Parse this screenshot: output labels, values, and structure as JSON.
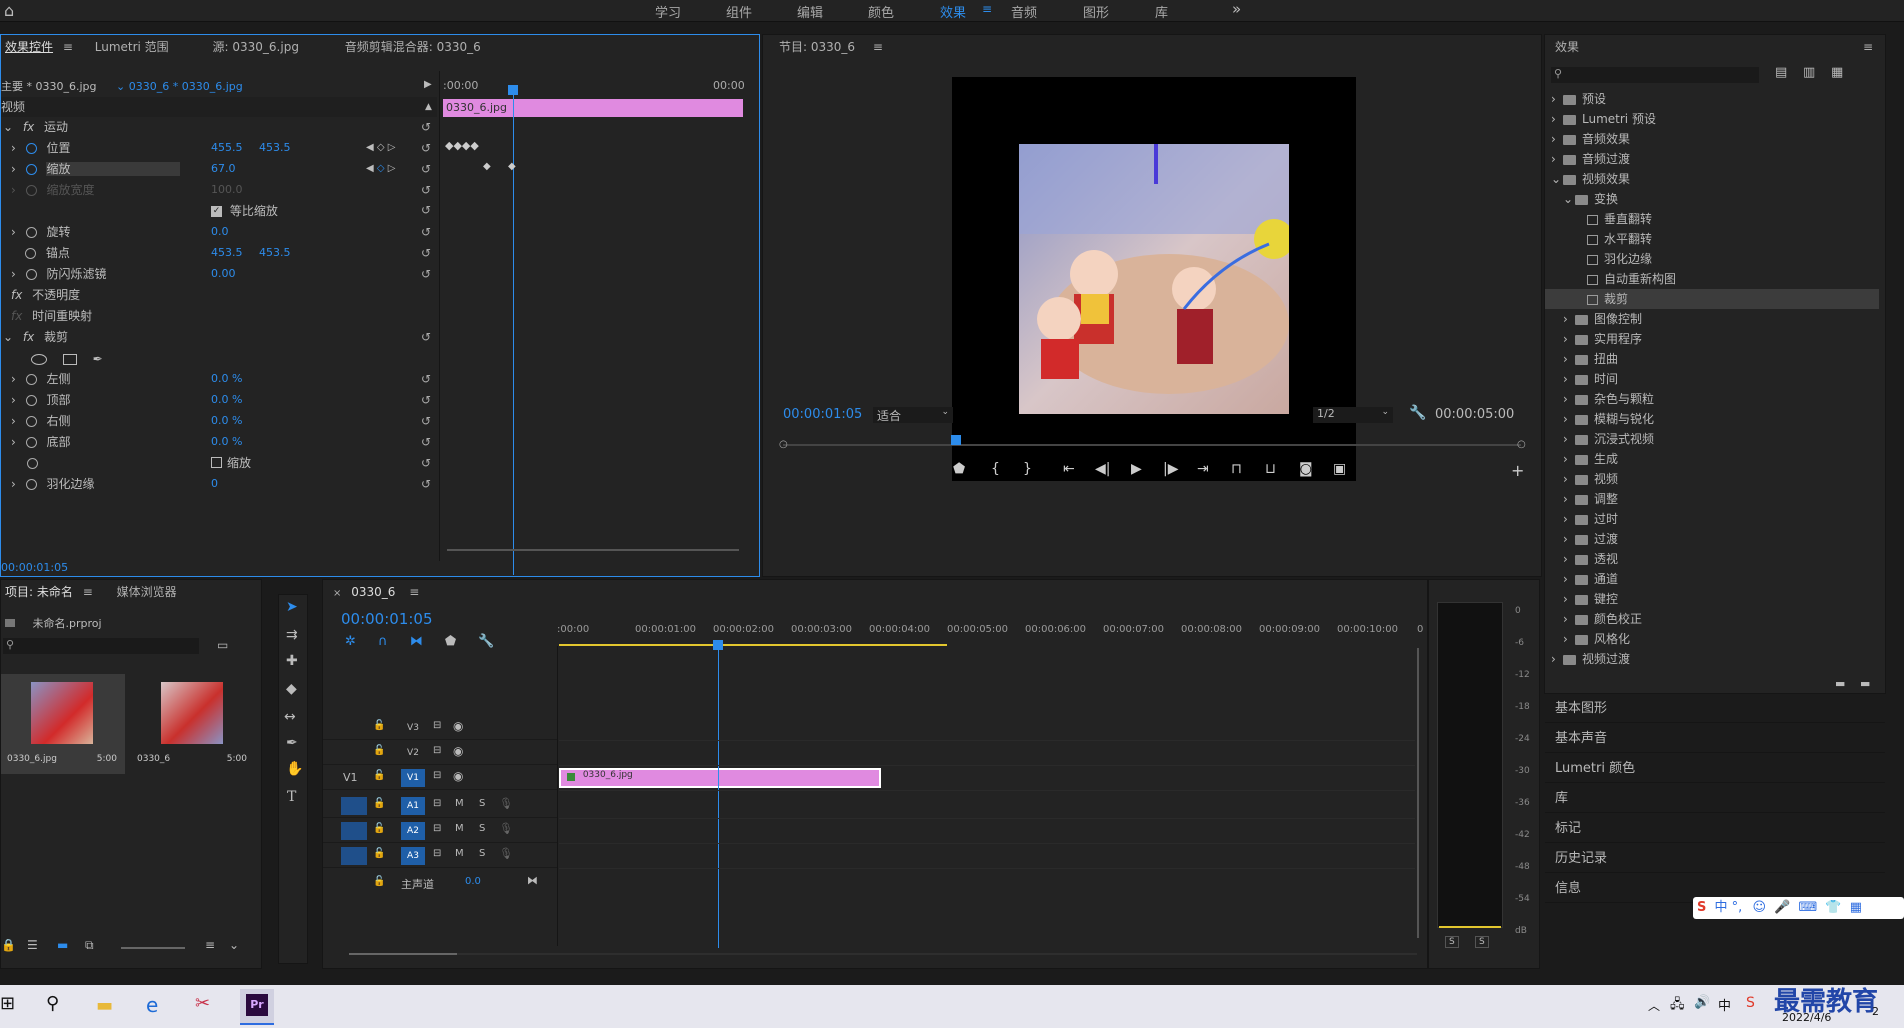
{
  "workspace_tabs": [
    "学习",
    "组件",
    "编辑",
    "颜色",
    "效果",
    "音频",
    "图形",
    "库"
  ],
  "workspace_active": "效果",
  "effect_controls": {
    "tabs": [
      "效果控件",
      "Lumetri 范围",
      "源: 0330_6.jpg",
      "音频剪辑混合器: 0330_6"
    ],
    "master": "主要 * 0330_6.jpg",
    "clip": "0330_6 * 0330_6.jpg",
    "video_label": "视频",
    "time_start": ":00:00",
    "time_end": "00:00",
    "clip_bar_label": "0330_6.jpg",
    "motion": "运动",
    "position": {
      "label": "位置",
      "x": "455.5",
      "y": "453.5"
    },
    "scale": {
      "label": "缩放",
      "value": "67.0"
    },
    "scale_width": {
      "label": "缩放宽度",
      "value": "100.0"
    },
    "uniform_scale": "等比缩放",
    "rotation": {
      "label": "旋转",
      "value": "0.0"
    },
    "anchor": {
      "label": "锚点",
      "x": "453.5",
      "y": "453.5"
    },
    "flicker": {
      "label": "防闪烁滤镜",
      "value": "0.00"
    },
    "opacity": "不透明度",
    "time_remap": "时间重映射",
    "crop": "裁剪",
    "crop_left": {
      "label": "左侧",
      "value": "0.0 %"
    },
    "crop_top": {
      "label": "顶部",
      "value": "0.0 %"
    },
    "crop_right": {
      "label": "右侧",
      "value": "0.0 %"
    },
    "crop_bottom": {
      "label": "底部",
      "value": "0.0 %"
    },
    "zoom_label": "缩放",
    "feather": {
      "label": "羽化边缘",
      "value": "0"
    },
    "timecode": "00:00:01:05"
  },
  "program": {
    "title": "节目: 0330_6",
    "timecode": "00:00:01:05",
    "fit": "适合",
    "quality": "1/2",
    "duration": "00:00:05:00"
  },
  "effects_panel": {
    "title": "效果",
    "items": [
      {
        "label": "预设",
        "indent": 0,
        "kind": "folder",
        "open": false
      },
      {
        "label": "Lumetri 预设",
        "indent": 0,
        "kind": "folder",
        "open": false
      },
      {
        "label": "音频效果",
        "indent": 0,
        "kind": "folder",
        "open": false
      },
      {
        "label": "音频过渡",
        "indent": 0,
        "kind": "folder",
        "open": false
      },
      {
        "label": "视频效果",
        "indent": 0,
        "kind": "folder",
        "open": true
      },
      {
        "label": "变换",
        "indent": 1,
        "kind": "folder",
        "open": true
      },
      {
        "label": "垂直翻转",
        "indent": 2,
        "kind": "fx"
      },
      {
        "label": "水平翻转",
        "indent": 2,
        "kind": "fx"
      },
      {
        "label": "羽化边缘",
        "indent": 2,
        "kind": "fx"
      },
      {
        "label": "自动重新构图",
        "indent": 2,
        "kind": "fx"
      },
      {
        "label": "裁剪",
        "indent": 2,
        "kind": "fx",
        "selected": true
      },
      {
        "label": "图像控制",
        "indent": 1,
        "kind": "folder"
      },
      {
        "label": "实用程序",
        "indent": 1,
        "kind": "folder"
      },
      {
        "label": "扭曲",
        "indent": 1,
        "kind": "folder"
      },
      {
        "label": "时间",
        "indent": 1,
        "kind": "folder"
      },
      {
        "label": "杂色与颗粒",
        "indent": 1,
        "kind": "folder"
      },
      {
        "label": "模糊与锐化",
        "indent": 1,
        "kind": "folder"
      },
      {
        "label": "沉浸式视频",
        "indent": 1,
        "kind": "folder"
      },
      {
        "label": "生成",
        "indent": 1,
        "kind": "folder"
      },
      {
        "label": "视频",
        "indent": 1,
        "kind": "folder"
      },
      {
        "label": "调整",
        "indent": 1,
        "kind": "folder"
      },
      {
        "label": "过时",
        "indent": 1,
        "kind": "folder"
      },
      {
        "label": "过渡",
        "indent": 1,
        "kind": "folder"
      },
      {
        "label": "透视",
        "indent": 1,
        "kind": "folder"
      },
      {
        "label": "通道",
        "indent": 1,
        "kind": "folder"
      },
      {
        "label": "键控",
        "indent": 1,
        "kind": "folder"
      },
      {
        "label": "颜色校正",
        "indent": 1,
        "kind": "folder"
      },
      {
        "label": "风格化",
        "indent": 1,
        "kind": "folder"
      },
      {
        "label": "视频过渡",
        "indent": 0,
        "kind": "folder"
      }
    ],
    "collapsed_panels": [
      "基本图形",
      "基本声音",
      "Lumetri 颜色",
      "库",
      "标记",
      "历史记录",
      "信息"
    ]
  },
  "project": {
    "tabs": [
      "项目: 未命名",
      "媒体浏览器"
    ],
    "file": "未命名.prproj",
    "items": [
      {
        "name": "0330_6.jpg",
        "dur": "5:00"
      },
      {
        "name": "0330_6",
        "dur": "5:00"
      }
    ]
  },
  "timeline": {
    "title": "0330_6",
    "timecode": "00:00:01:05",
    "ruler": [
      ":00:00",
      "00:00:01:00",
      "00:00:02:00",
      "00:00:03:00",
      "00:00:04:00",
      "00:00:05:00",
      "00:00:06:00",
      "00:00:07:00",
      "00:00:08:00",
      "00:00:09:00",
      "00:00:10:00",
      "0"
    ],
    "video_tracks": [
      "V3",
      "V2",
      "V1"
    ],
    "audio_tracks": [
      "A1",
      "A2",
      "A3"
    ],
    "source_patch": "V1",
    "master": "主声道",
    "master_val": "0.0",
    "clip_label": "0330_6.jpg",
    "mute": "M",
    "solo": "S"
  },
  "meter": {
    "labels": [
      "0",
      "-6",
      "-12",
      "-18",
      "-24",
      "-30",
      "-36",
      "-42",
      "-48",
      "-54",
      "dB"
    ],
    "solo": [
      "S",
      "S"
    ]
  },
  "taskbar": {
    "ime": "中",
    "date": "2022/4/6",
    "watermark": "最需教育",
    "notify": "2"
  }
}
